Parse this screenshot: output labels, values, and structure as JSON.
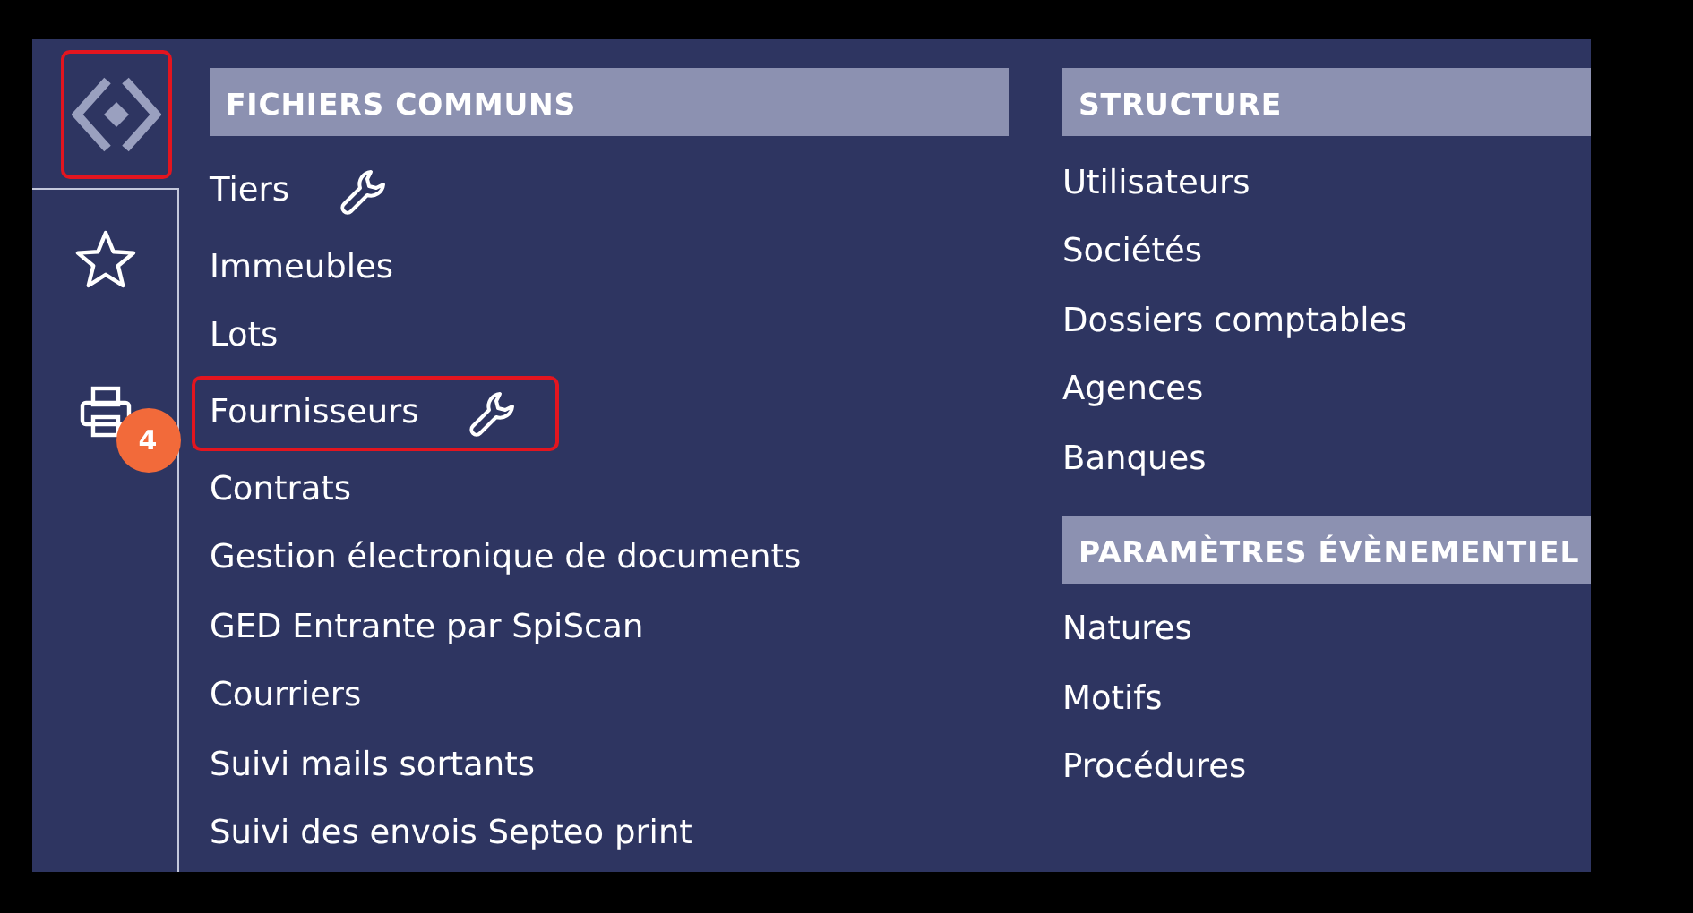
{
  "sidebar": {
    "logo": {
      "highlighted": true
    },
    "items": [
      {
        "kind": "favorites"
      },
      {
        "kind": "print",
        "badge": "4"
      }
    ]
  },
  "columns": [
    {
      "sections": [
        {
          "title": "FICHIERS COMMUNS",
          "items": [
            {
              "label": "Tiers",
              "has_settings": true,
              "highlighted": false
            },
            {
              "label": "Immeubles",
              "has_settings": false,
              "highlighted": false
            },
            {
              "label": "Lots",
              "has_settings": false,
              "highlighted": false
            },
            {
              "label": "Fournisseurs",
              "has_settings": true,
              "highlighted": true
            },
            {
              "label": "Contrats",
              "has_settings": false,
              "highlighted": false
            },
            {
              "label": "Gestion électronique de documents",
              "has_settings": false,
              "highlighted": false
            },
            {
              "label": "GED Entrante par SpiScan",
              "has_settings": false,
              "highlighted": false
            },
            {
              "label": "Courriers",
              "has_settings": false,
              "highlighted": false
            },
            {
              "label": "Suivi mails sortants",
              "has_settings": false,
              "highlighted": false
            },
            {
              "label": "Suivi des envois Septeo print",
              "has_settings": false,
              "highlighted": false
            }
          ]
        }
      ]
    },
    {
      "sections": [
        {
          "title": "STRUCTURE",
          "items": [
            {
              "label": "Utilisateurs",
              "has_settings": false,
              "highlighted": false
            },
            {
              "label": "Sociétés",
              "has_settings": false,
              "highlighted": false
            },
            {
              "label": "Dossiers comptables",
              "has_settings": false,
              "highlighted": false
            },
            {
              "label": "Agences",
              "has_settings": false,
              "highlighted": false
            },
            {
              "label": "Banques",
              "has_settings": false,
              "highlighted": false
            }
          ]
        },
        {
          "title": "PARAMÈTRES ÉVÈNEMENTIEL",
          "items": [
            {
              "label": "Natures",
              "has_settings": false,
              "highlighted": false
            },
            {
              "label": "Motifs",
              "has_settings": false,
              "highlighted": false
            },
            {
              "label": "Procédures",
              "has_settings": false,
              "highlighted": false
            }
          ]
        }
      ]
    }
  ]
}
